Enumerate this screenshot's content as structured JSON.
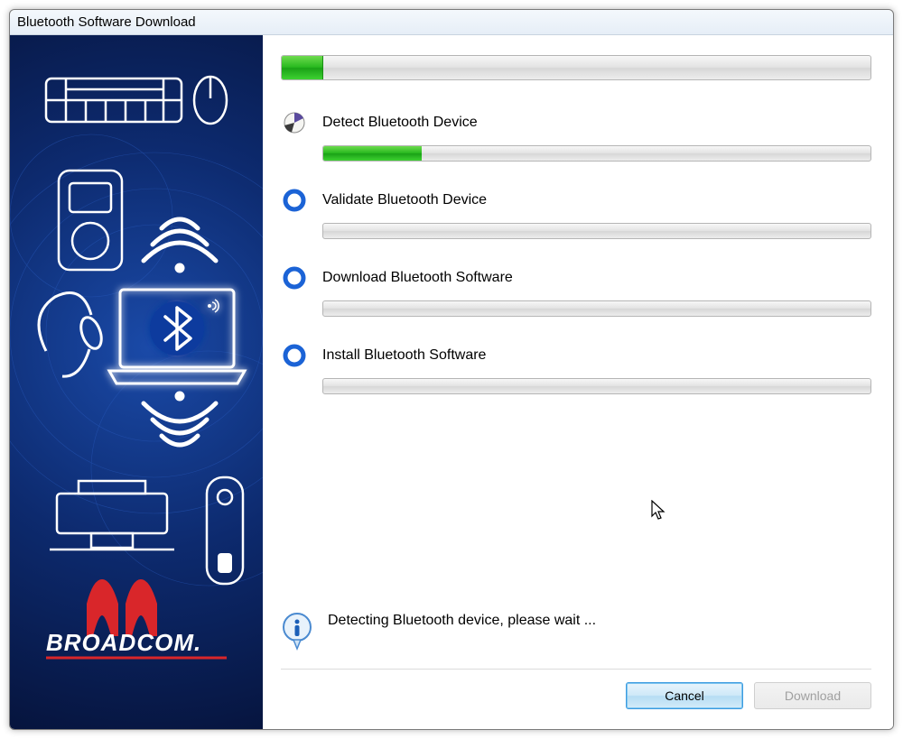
{
  "window": {
    "title": "Bluetooth Software Download"
  },
  "overall_progress_percent": 7,
  "steps": [
    {
      "label": "Detect Bluetooth Device",
      "state": "active",
      "progress_percent": 18
    },
    {
      "label": "Validate Bluetooth Device",
      "state": "pending",
      "progress_percent": 0
    },
    {
      "label": "Download Bluetooth Software",
      "state": "pending",
      "progress_percent": 0
    },
    {
      "label": "Install Bluetooth Software",
      "state": "pending",
      "progress_percent": 0
    }
  ],
  "status": {
    "message": "Detecting Bluetooth device, please wait ..."
  },
  "buttons": {
    "cancel": "Cancel",
    "download": "Download"
  },
  "brand": "BROADCOM."
}
